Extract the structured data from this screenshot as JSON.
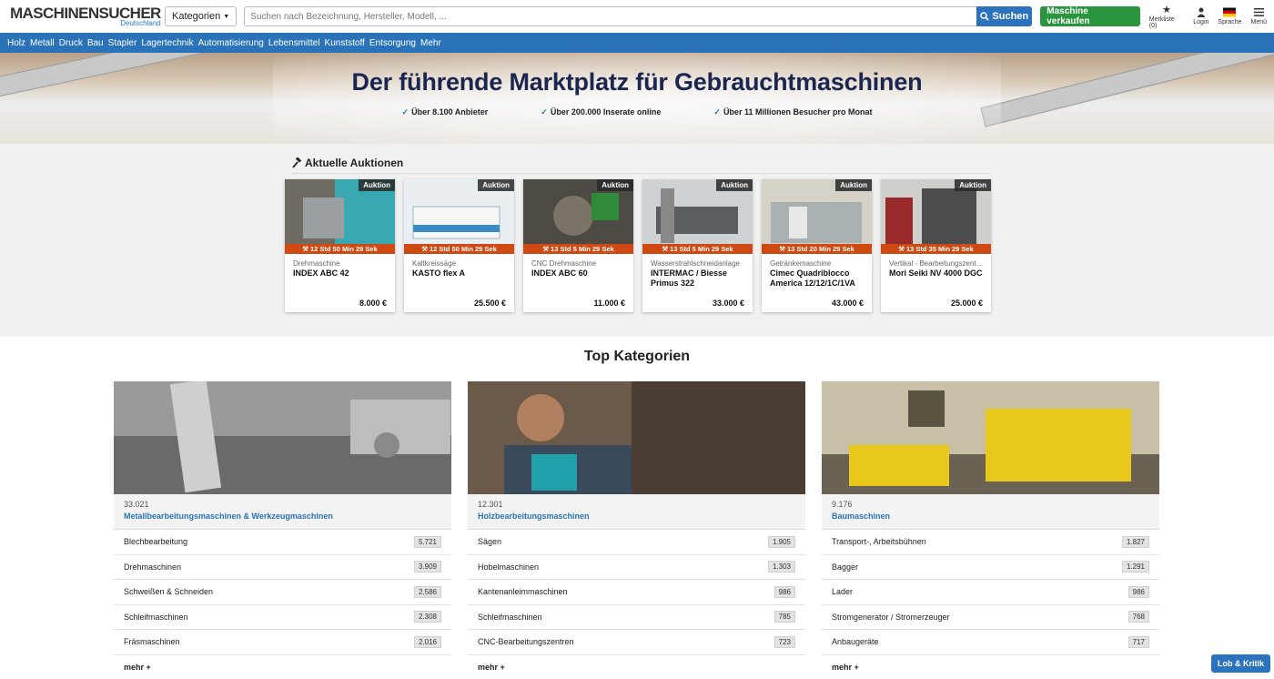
{
  "header": {
    "logo_title": "MASCHINENSUCHER",
    "logo_sub": "Deutschland",
    "category_btn": "Kategorien",
    "search_placeholder": "Suchen nach Bezeichnung, Hersteller, Modell, ...",
    "search_btn": "Suchen",
    "sell_btn": "Maschine verkaufen",
    "merkliste": "Merkliste (0)",
    "login": "Login",
    "sprache": "Sprache",
    "menu": "Menü"
  },
  "nav": [
    "Holz",
    "Metall",
    "Druck",
    "Bau",
    "Stapler",
    "Lagertechnik",
    "Automatisierung",
    "Lebensmittel",
    "Kunststoff",
    "Entsorgung",
    "Mehr"
  ],
  "hero": {
    "title": "Der führende Marktplatz für Gebrauchtmaschinen",
    "points": [
      "Über 8.100 Anbieter",
      "Über 200.000 Inserate online",
      "Über 11 Millionen Besucher pro Monat"
    ]
  },
  "auctions": {
    "heading": "Aktuelle Auktionen",
    "badge": "Auktion",
    "items": [
      {
        "timer": "12 Std 50 Min 29 Sek",
        "category": "Drehmaschine",
        "title": "INDEX ABC 42",
        "price": "8.000 €",
        "color": "#7f7a70"
      },
      {
        "timer": "12 Std 50 Min 29 Sek",
        "category": "Kaltkreissäge",
        "title": "KASTO flex A",
        "price": "25.500 €",
        "color": "#c8d4dc"
      },
      {
        "timer": "13 Std 5 Min 29 Sek",
        "category": "CNC Drehmaschine",
        "title": "INDEX ABC 60",
        "price": "11.000 €",
        "color": "#5a5a52"
      },
      {
        "timer": "13 Std 5 Min 29 Sek",
        "category": "Wasserstrahlschneidanlage",
        "title": "INTERMAC / Biesse Primus 322",
        "price": "33.000 €",
        "color": "#a8a8a6"
      },
      {
        "timer": "13 Std 20 Min 29 Sek",
        "category": "Getränkemaschine",
        "title": "Cimec Quadriblocco America 12/12/1C/1VA",
        "price": "43.000 €",
        "color": "#bcbab2"
      },
      {
        "timer": "13 Std 35 Min 29 Sek",
        "category": "Vertikal - Bearbeitungszentrum",
        "title": "Mori Seiki NV 4000 DGC",
        "price": "25.000 €",
        "color": "#8a8a86"
      }
    ]
  },
  "topcats": {
    "heading": "Top Kategorien",
    "more": "mehr",
    "columns": [
      {
        "count": "33.021",
        "name": "Metallbearbeitungsmaschinen & Werkzeugmaschinen",
        "rows": [
          {
            "label": "Blechbearbeitung",
            "n": "5.721"
          },
          {
            "label": "Drehmaschinen",
            "n": "3.909"
          },
          {
            "label": "Schweißen & Schneiden",
            "n": "2.586"
          },
          {
            "label": "Schleifmaschinen",
            "n": "2.308"
          },
          {
            "label": "Fräsmaschinen",
            "n": "2.016"
          }
        ]
      },
      {
        "count": "12.301",
        "name": "Holzbearbeitungsmaschinen",
        "rows": [
          {
            "label": "Sägen",
            "n": "1.905"
          },
          {
            "label": "Hobelmaschinen",
            "n": "1.303"
          },
          {
            "label": "Kantenanleimmaschinen",
            "n": "986"
          },
          {
            "label": "Schleifmaschinen",
            "n": "785"
          },
          {
            "label": "CNC-Bearbeitungszentren",
            "n": "723"
          }
        ]
      },
      {
        "count": "9.176",
        "name": "Baumaschinen",
        "rows": [
          {
            "label": "Transport-, Arbeitsbühnen",
            "n": "1.827"
          },
          {
            "label": "Bagger",
            "n": "1.291"
          },
          {
            "label": "Lader",
            "n": "986"
          },
          {
            "label": "Stromgenerator / Stromerzeuger",
            "n": "768"
          },
          {
            "label": "Anbaugeräte",
            "n": "717"
          }
        ]
      }
    ]
  },
  "feedback": "Lob & Kritik",
  "colors": {
    "brand_blue": "#2a73b9",
    "sell_green": "#29963e",
    "timer_orange": "#cf4a12",
    "hero_title": "#1a2550"
  }
}
